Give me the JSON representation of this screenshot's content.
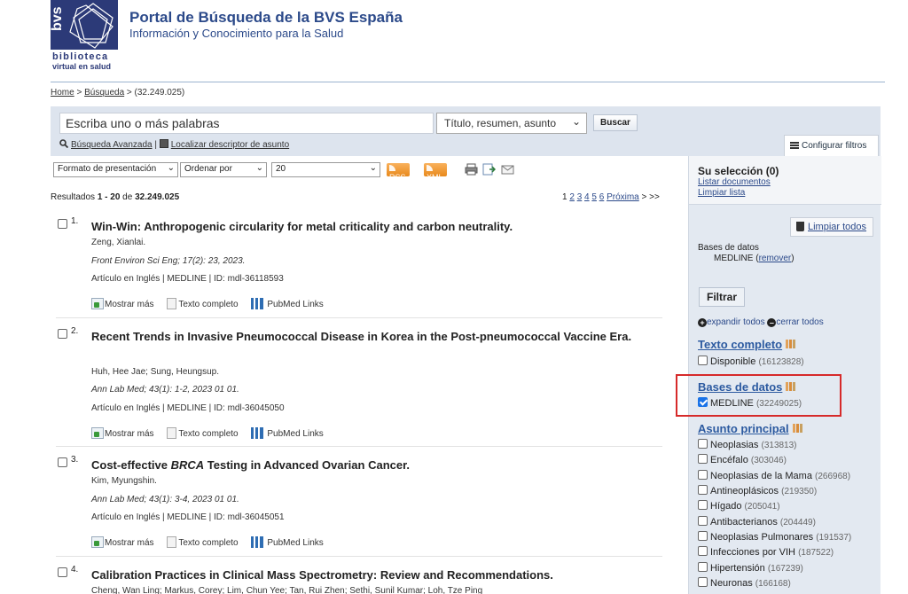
{
  "header": {
    "logo_mark": "bvs",
    "logo_line1": "biblioteca",
    "logo_line2": "virtual en salud",
    "title": "Portal de Búsqueda de la BVS España",
    "subtitle": "Información y Conocimiento para la Salud"
  },
  "breadcrumb": {
    "home": "Home",
    "sep1": " > ",
    "search": "Búsqueda",
    "current": " > (32.249.025)"
  },
  "search": {
    "placeholder": "Escriba uno o más palabras",
    "field_select": "Título, resumen, asunto",
    "button": "Buscar",
    "advanced": "Búsqueda Avanzada",
    "divider": "|",
    "descriptor": "Localizar descriptor de asunto",
    "config_filters": "Configurar filtros"
  },
  "toolbar": {
    "format": "Formato de presentación",
    "order": "Ordenar por",
    "per_page": "20",
    "rss": "RSS",
    "xml": "XML"
  },
  "results_summary": {
    "prefix": "Resultados ",
    "range": "1 - 20",
    "of": " de ",
    "total": "32.249.025"
  },
  "pager": {
    "current": "1",
    "pages": [
      "2",
      "3",
      "4",
      "5",
      "6"
    ],
    "next": "Próxima",
    "arrows": "> >>"
  },
  "actions": {
    "more": "Mostrar más",
    "full_text": "Texto completo",
    "pubmed": "PubMed Links"
  },
  "results": [
    {
      "num": "1.",
      "title": "Win-Win: Anthropogenic circularity for metal criticality and carbon neutrality.",
      "authors": "Zeng, Xianlai.",
      "source": "Front Environ Sci Eng; 17(2): 23, 2023.",
      "meta": "Artículo en Inglés | MEDLINE | ID: mdl-36118593"
    },
    {
      "num": "2.",
      "title": "Recent Trends in Invasive Pneumococcal Disease in Korea in the Post-pneumococcal Vaccine Era.",
      "authors": "Huh, Hee Jae; Sung, Heungsup.",
      "source": "Ann Lab Med; 43(1): 1-2, 2023 01 01.",
      "meta": "Artículo en Inglés | MEDLINE | ID: mdl-36045050"
    },
    {
      "num": "3.",
      "title_pre": "Cost-effective ",
      "title_em": "BRCA",
      "title_post": " Testing in Advanced Ovarian Cancer.",
      "authors": "Kim, Myungshin.",
      "source": "Ann Lab Med; 43(1): 3-4, 2023 01 01.",
      "meta": "Artículo en Inglés | MEDLINE | ID: mdl-36045051"
    },
    {
      "num": "4.",
      "title": "Calibration Practices in Clinical Mass Spectrometry: Review and Recommendations.",
      "authors": "Cheng, Wan Ling; Markus, Corey; Lim, Chun Yee; Tan, Rui Zhen; Sethi, Sunil Kumar; Loh, Tze Ping"
    }
  ],
  "sidebar": {
    "selection_title": "Su selección (0)",
    "list_docs": "Listar documentos",
    "clear_list": "Limpiar lista",
    "clear_all": "Limpiar todos",
    "db_label": "Bases de datos",
    "db_value": "MEDLINE",
    "remove": "remover",
    "filter_button": "Filtrar",
    "expand_all": "expandir todos",
    "collapse_all": "cerrar todos",
    "facets": {
      "full_text": {
        "title": "Texto completo",
        "items": [
          {
            "label": "Disponible",
            "count": "(16123828)"
          }
        ]
      },
      "databases": {
        "title": "Bases de datos",
        "items": [
          {
            "label": "MEDLINE",
            "count": "(32249025)"
          }
        ]
      },
      "main_subject": {
        "title": "Asunto principal",
        "items": [
          {
            "label": "Neoplasias",
            "count": "(313813)"
          },
          {
            "label": "Encéfalo",
            "count": "(303046)"
          },
          {
            "label": "Neoplasias de la Mama",
            "count": "(266968)"
          },
          {
            "label": "Antineoplásicos",
            "count": "(219350)"
          },
          {
            "label": "Hígado",
            "count": "(205041)"
          },
          {
            "label": "Antibacterianos",
            "count": "(204449)"
          },
          {
            "label": "Neoplasias Pulmonares",
            "count": "(191537)"
          },
          {
            "label": "Infecciones por VIH",
            "count": "(187522)"
          },
          {
            "label": "Hipertensión",
            "count": "(167239)"
          },
          {
            "label": "Neuronas",
            "count": "(166168)"
          }
        ]
      }
    }
  },
  "colors": {
    "brand": "#2c3a78",
    "link": "#2c4a8a",
    "highlight": "#d62a2a",
    "panel": "#e3e9f1"
  }
}
